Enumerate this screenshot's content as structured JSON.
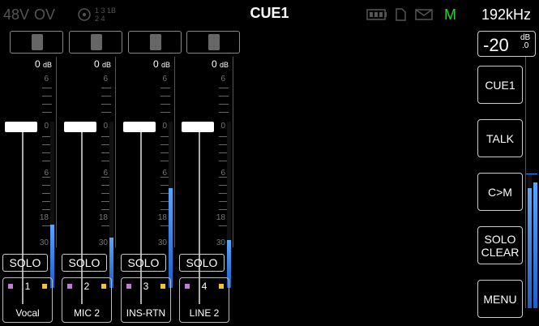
{
  "status": {
    "phantom": "48V",
    "overload": "OV",
    "link_top": "1 3 1B",
    "link_bottom": "2 4",
    "monitor_flag": "M",
    "sample_rate": "192kHz",
    "title": "CUE1"
  },
  "icons": [
    "link-icon",
    "battery-icon",
    "card-icon",
    "mail-icon"
  ],
  "master": {
    "level_value": "-20",
    "level_unit_top": "dB",
    "level_unit_bottom": ".0"
  },
  "scale": [
    "6",
    "0",
    "6",
    "18",
    "30"
  ],
  "channels": [
    {
      "number": "1",
      "name": "Vocal",
      "db_value": "0",
      "db_unit": "dB",
      "solo": "SOLO",
      "fader_level_db": 0,
      "meter_level": 0.38
    },
    {
      "number": "2",
      "name": "MIC 2",
      "db_value": "0",
      "db_unit": "dB",
      "solo": "SOLO",
      "fader_level_db": 0,
      "meter_level": 0.3
    },
    {
      "number": "3",
      "name": "INS-RTN",
      "db_value": "0",
      "db_unit": "dB",
      "solo": "SOLO",
      "fader_level_db": 0,
      "meter_level": 0.6
    },
    {
      "number": "4",
      "name": "LINE 2",
      "db_value": "0",
      "db_unit": "dB",
      "solo": "SOLO",
      "fader_level_db": 0,
      "meter_level": 0.29
    }
  ],
  "buttons": {
    "cue1": "CUE1",
    "talk": "TALK",
    "cm": "C>M",
    "solo_clear_1": "SOLO",
    "solo_clear_2": "CLEAR",
    "menu": "MENU"
  },
  "colors": {
    "accent": "#2e8fff",
    "monitor": "#2ecc40",
    "marker_purple": "#c27ad6",
    "marker_yellow": "#f4c430"
  }
}
